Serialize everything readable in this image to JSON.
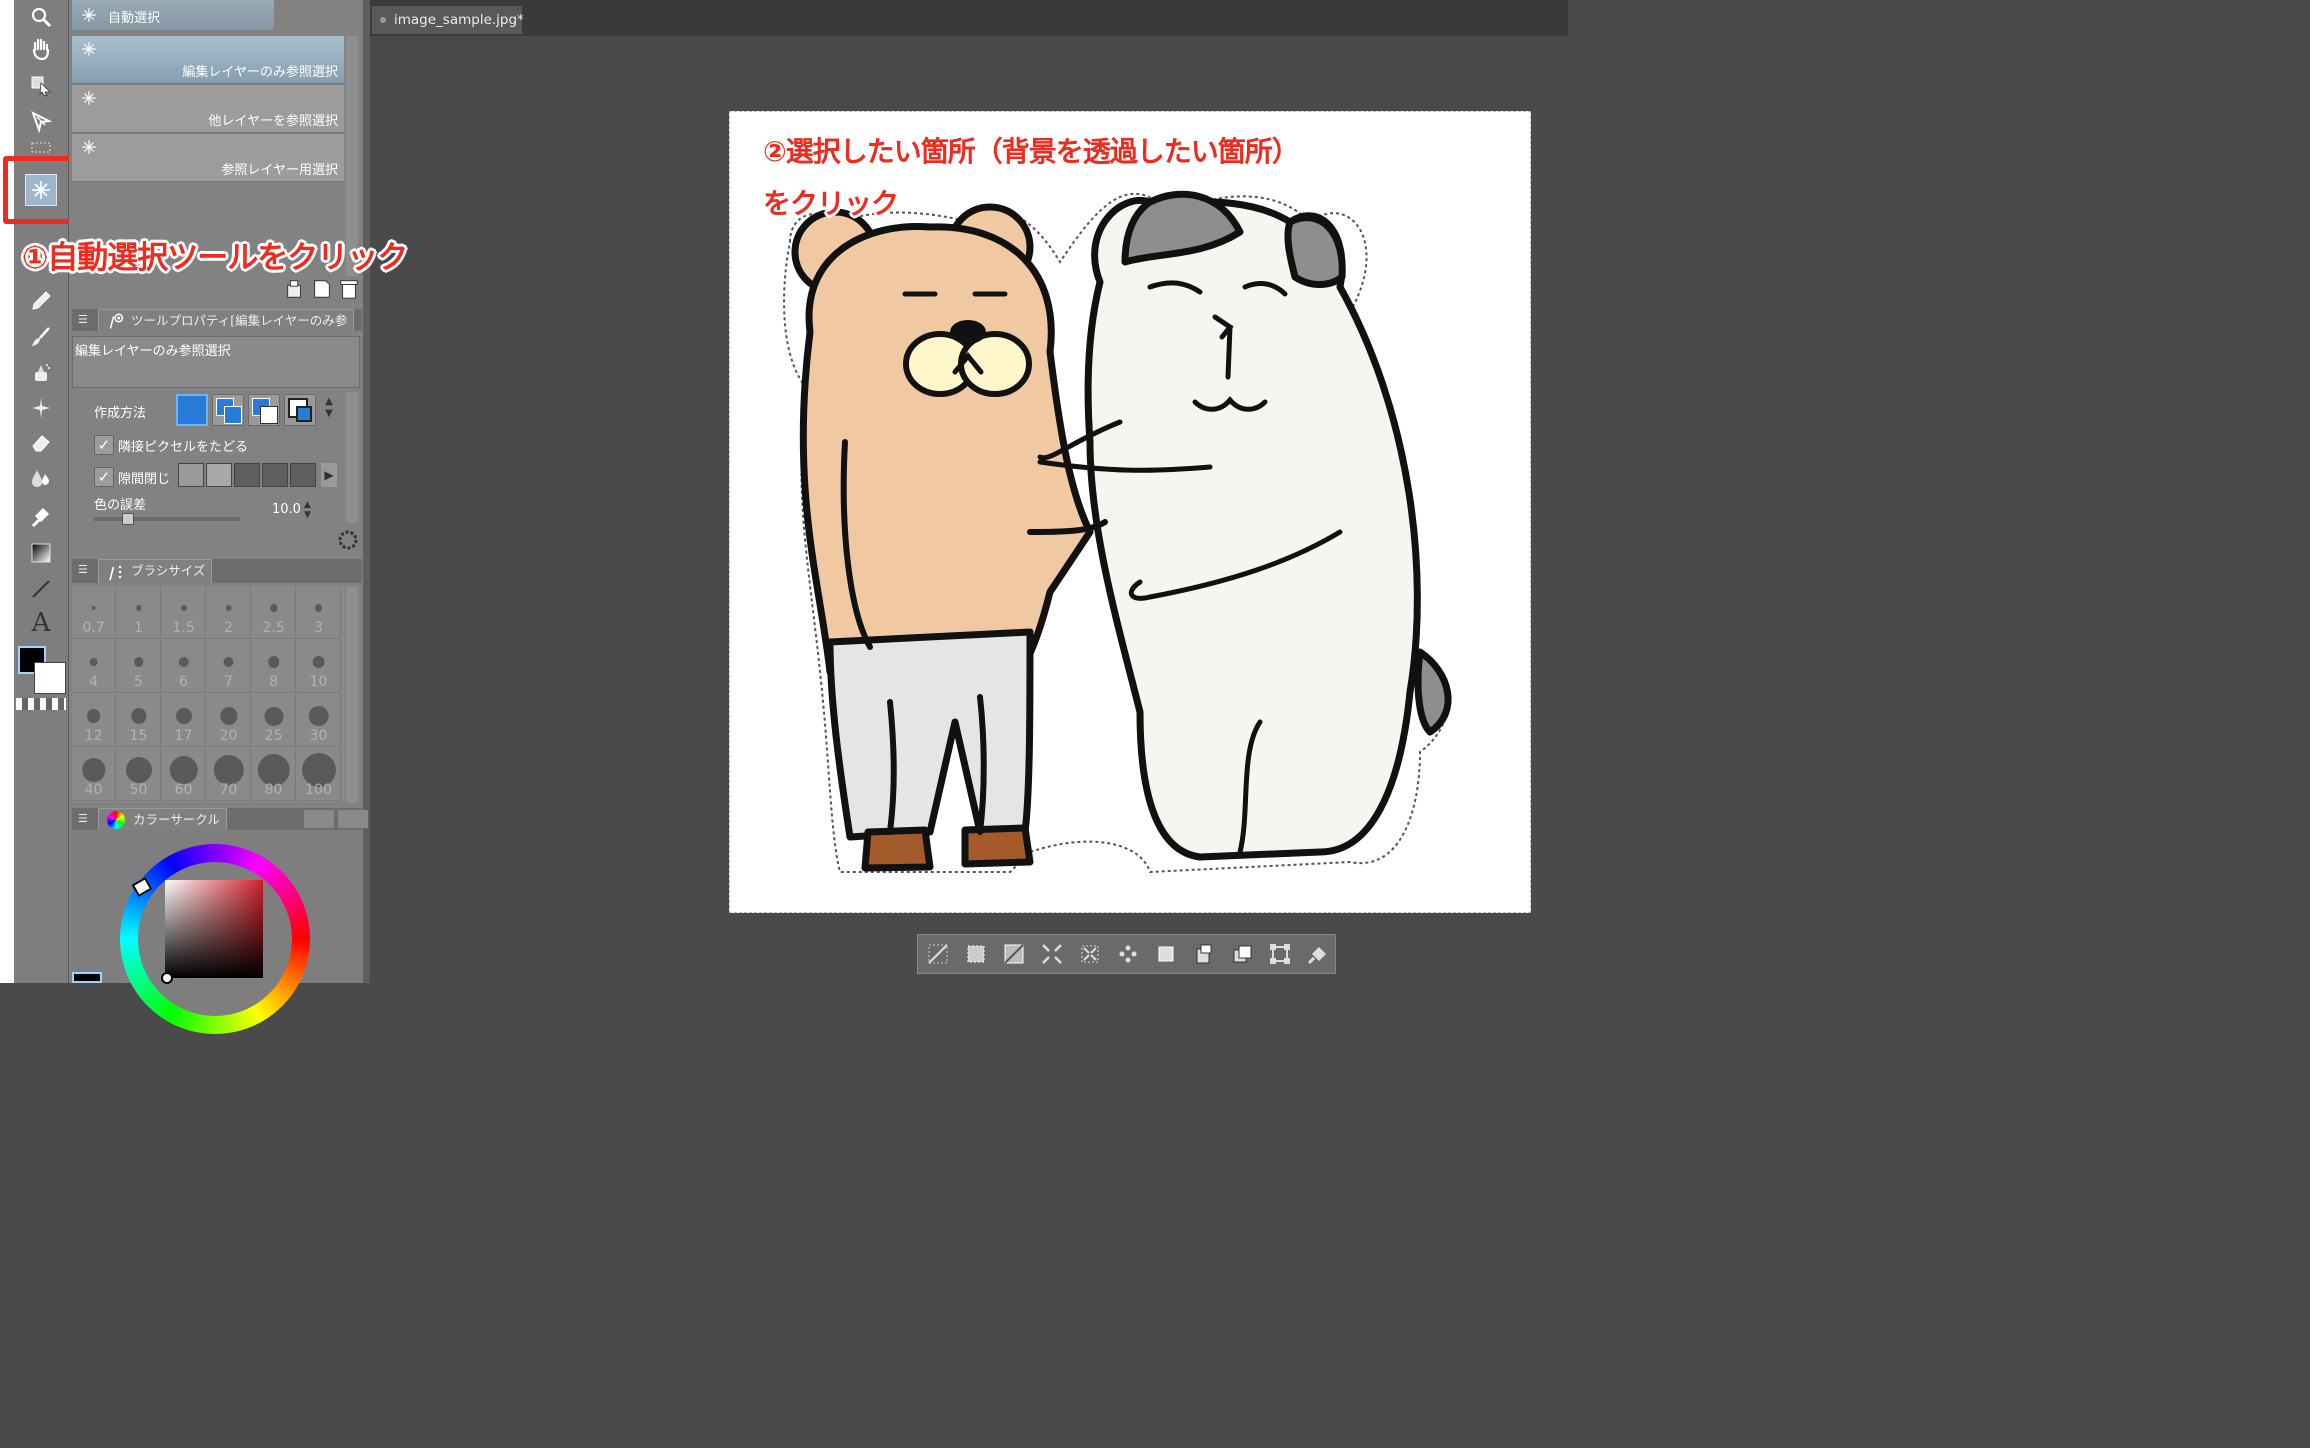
{
  "document_tab": {
    "title": "image_sample.jpg*"
  },
  "subtool": {
    "header": "自動選択",
    "items": [
      {
        "label": "編集レイヤーのみ参照選択",
        "selected": true
      },
      {
        "label": "他レイヤーを参照選択",
        "selected": false
      },
      {
        "label": "参照レイヤー用選択",
        "selected": false
      }
    ]
  },
  "tool_property": {
    "title": "ツールプロパティ[編集レイヤーのみ参",
    "subtool_name": "編集レイヤーのみ参照選択",
    "creation_method_label": "作成方法",
    "follow_adjacent_label": "隣接ピクセルをたどる",
    "follow_adjacent_checked": true,
    "close_gap_label": "隙間閉じ",
    "close_gap_checked": true,
    "color_tolerance_label": "色の誤差",
    "color_tolerance_value": "10.0"
  },
  "brush_size": {
    "title": "ブラシサイズ",
    "sizes": [
      "0.7",
      "1",
      "1.5",
      "2",
      "2.5",
      "3",
      "4",
      "5",
      "6",
      "7",
      "8",
      "10",
      "12",
      "15",
      "17",
      "20",
      "25",
      "30",
      "40",
      "50",
      "60",
      "70",
      "80",
      "100"
    ]
  },
  "color_circle": {
    "title": "カラーサークル"
  },
  "annotations": {
    "step1": "①自動選択ツールをクリック",
    "step2_line1": "②選択したい箇所（背景を透過したい箇所）",
    "step2_line2": "をクリック"
  },
  "colors": {
    "highlight": "#ee2b1f",
    "bear_fur": "#f0c9a2",
    "cat_fur": "#f7f5f0",
    "cat_patch": "#8e8e8e",
    "selected_mode_blue": "#2a7ad8"
  }
}
